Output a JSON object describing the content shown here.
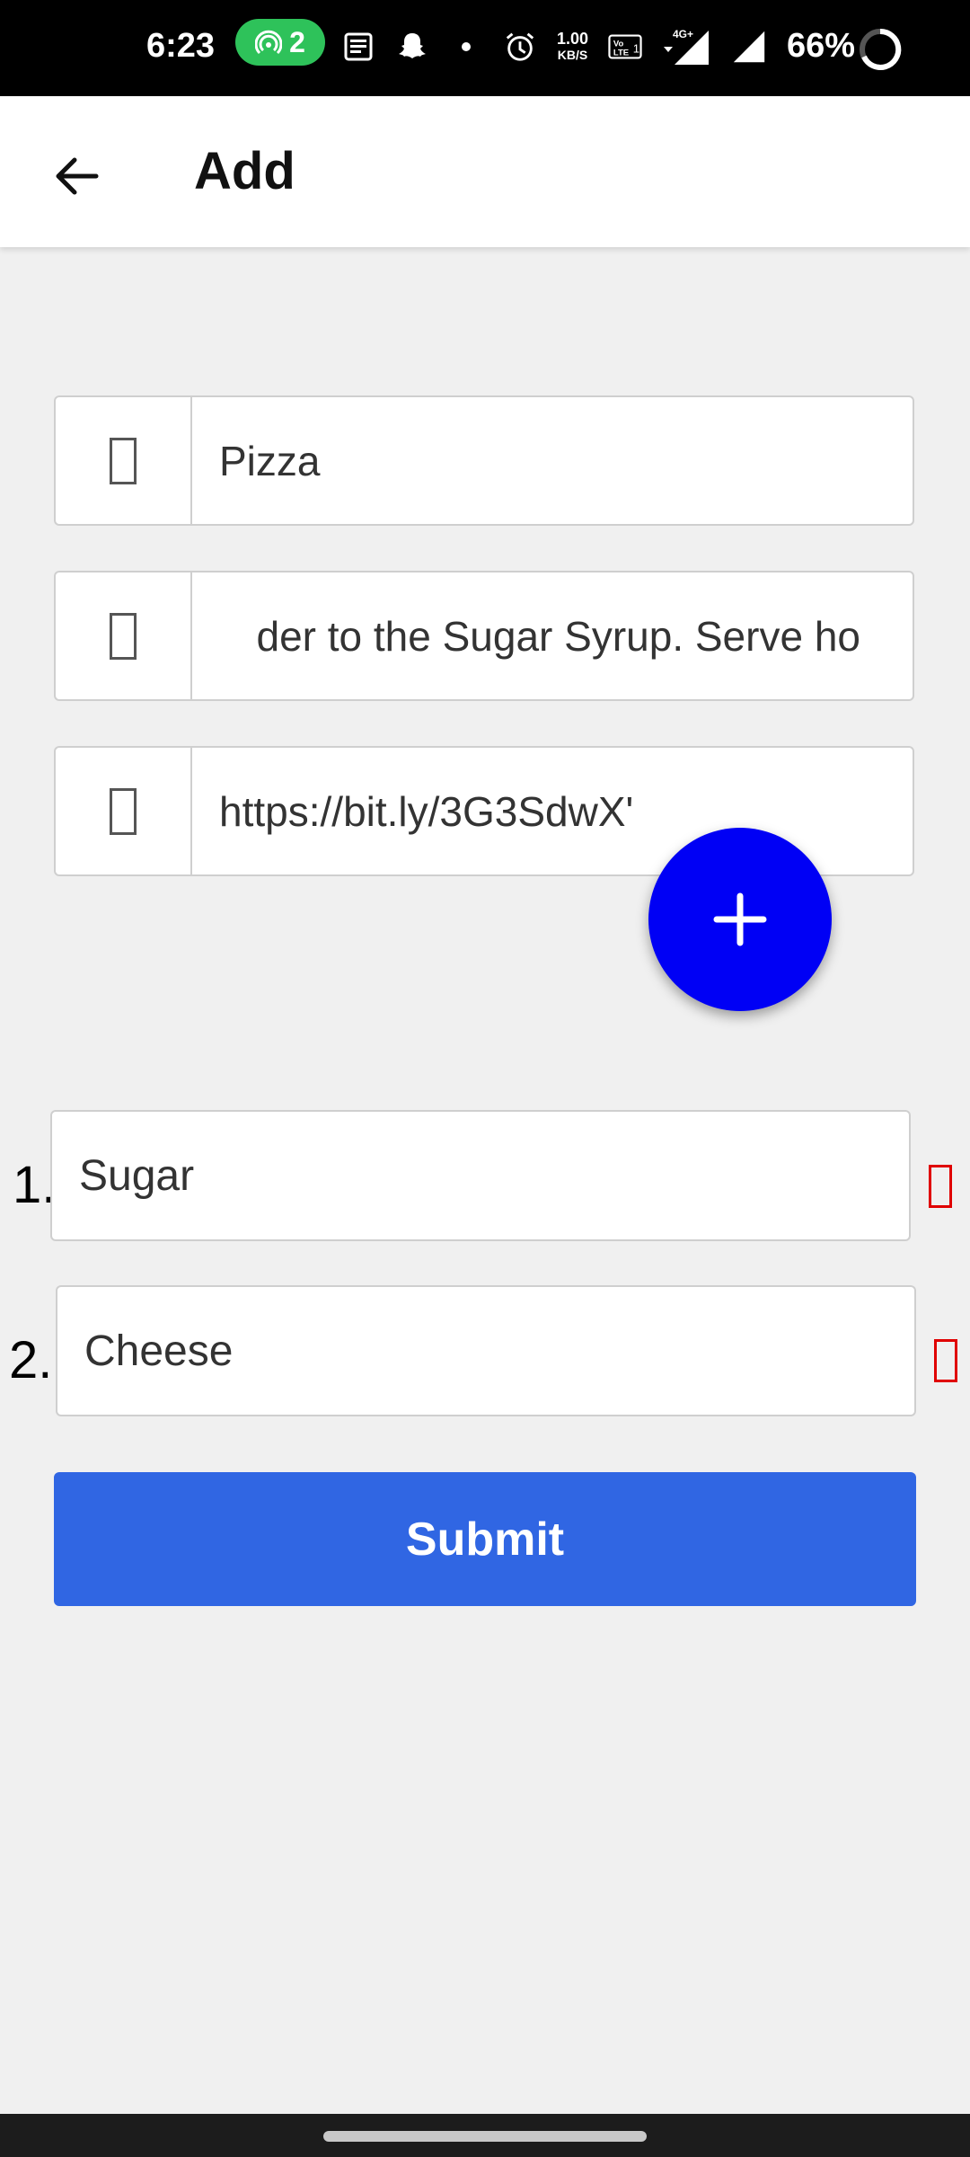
{
  "status_bar": {
    "time": "6:23",
    "hotspot_count": "2",
    "speed_top": "1.00",
    "speed_bottom": "KB/S",
    "network": "4G+",
    "battery": "66%"
  },
  "app_bar": {
    "title": "Add"
  },
  "form": {
    "name_value": "Pizza",
    "description_value": "der to the Sugar Syrup. Serve ho",
    "link_value": "https://bit.ly/3G3SdwX'"
  },
  "ingredients": [
    {
      "number": "1.",
      "value": "Sugar"
    },
    {
      "number": "2.",
      "value": "Cheese"
    }
  ],
  "submit_label": "Submit",
  "colors": {
    "fab": "#0000f5",
    "submit": "#3066e3",
    "delete": "#e00000"
  }
}
